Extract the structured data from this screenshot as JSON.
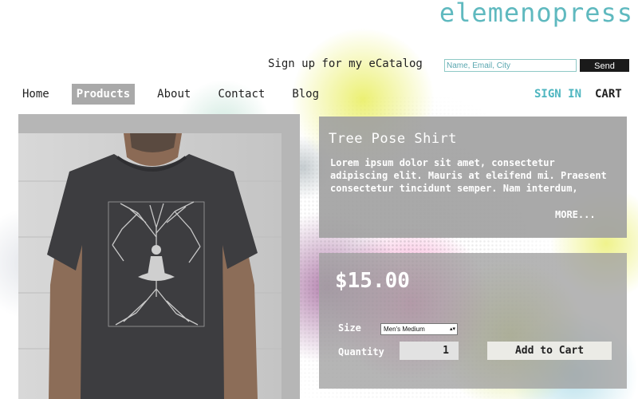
{
  "brand": {
    "logo": "elemenopress"
  },
  "signup": {
    "label": "Sign up for my eCatalog",
    "placeholder": "Name, Email, City",
    "send_label": "Send"
  },
  "nav": {
    "items": [
      {
        "label": "Home"
      },
      {
        "label": "Products",
        "active": true
      },
      {
        "label": "About"
      },
      {
        "label": "Contact"
      },
      {
        "label": "Blog"
      }
    ],
    "signin_label": "SIGN IN",
    "cart_label": "CART"
  },
  "product": {
    "title": "Tree Pose Shirt",
    "description": "Lorem ipsum dolor sit amet, consectetur adipiscing elit. Mauris at eleifend mi. Praesent consectetur tincidunt semper. Nam interdum,",
    "more_label": "MORE...",
    "price": "$15.00",
    "size_label": "Size",
    "size_selected": "Men's Medium",
    "quantity_label": "Quantity",
    "quantity_value": "1",
    "add_to_cart_label": "Add to Cart"
  },
  "colors": {
    "logo": "#5fb9bf",
    "signin": "#4fb6c0",
    "nav_active_bg": "#a9a9a9",
    "panel_bg": "#a0a0a0",
    "shirt": "#3d3d40",
    "paint_magenta": "#e80082",
    "paint_yellow": "#dce400",
    "paint_purple": "#7a2170"
  }
}
